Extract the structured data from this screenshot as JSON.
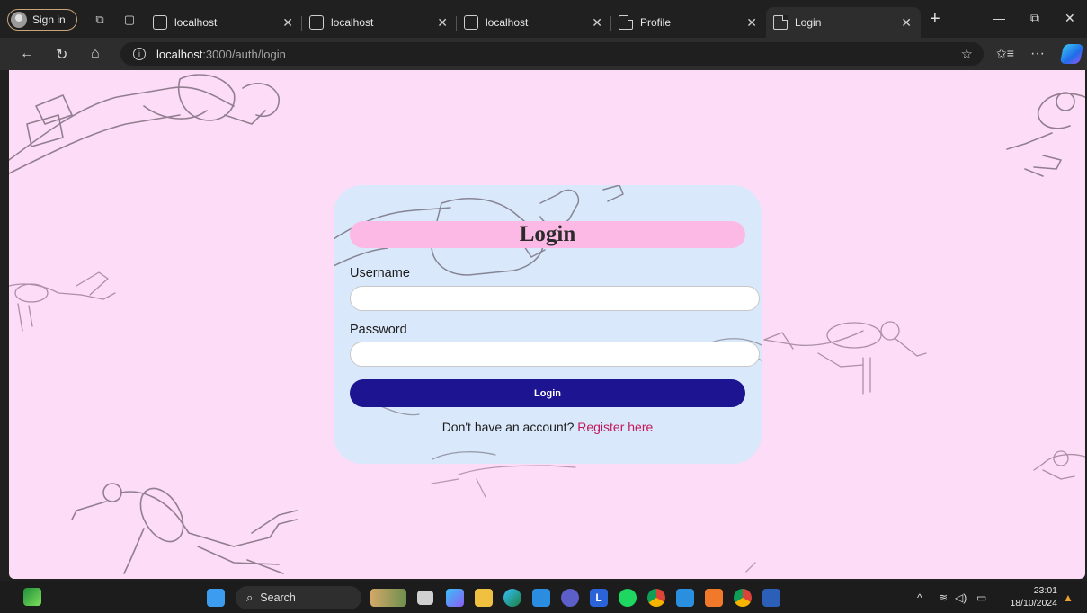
{
  "browser": {
    "signin_label": "Sign in",
    "tabs": [
      {
        "title": "localhost",
        "icon": "globe-icon"
      },
      {
        "title": "localhost",
        "icon": "globe-icon"
      },
      {
        "title": "localhost",
        "icon": "globe-icon"
      },
      {
        "title": "Profile",
        "icon": "page-icon"
      },
      {
        "title": "Login",
        "icon": "page-icon",
        "active": true
      }
    ],
    "address": {
      "host": "localhost",
      "path": ":3000/auth/login"
    }
  },
  "login": {
    "title": "Login",
    "username_label": "Username",
    "username_value": "",
    "password_label": "Password",
    "password_value": "",
    "submit_label": "Login",
    "register_prompt": "Don't have an account?",
    "register_link": "Register here"
  },
  "taskbar": {
    "search_label": "Search",
    "time": "23:01",
    "date": "18/10/2024",
    "apps": [
      "widgets-icon",
      "file-explorer-icon",
      "copilot-icon",
      "folder-icon",
      "edge-icon",
      "mail-icon",
      "teams-icon",
      "l-app-icon",
      "spotify-icon",
      "chrome-icon",
      "vscode-icon",
      "xampp-icon",
      "chrome-alt-icon",
      "word-icon"
    ]
  },
  "colors": {
    "page_background": "#fcdcf6",
    "card_background": "#d6e8fa",
    "title_pill": "#fdb9e6",
    "button": "#1d1491",
    "link": "#c2185b"
  }
}
